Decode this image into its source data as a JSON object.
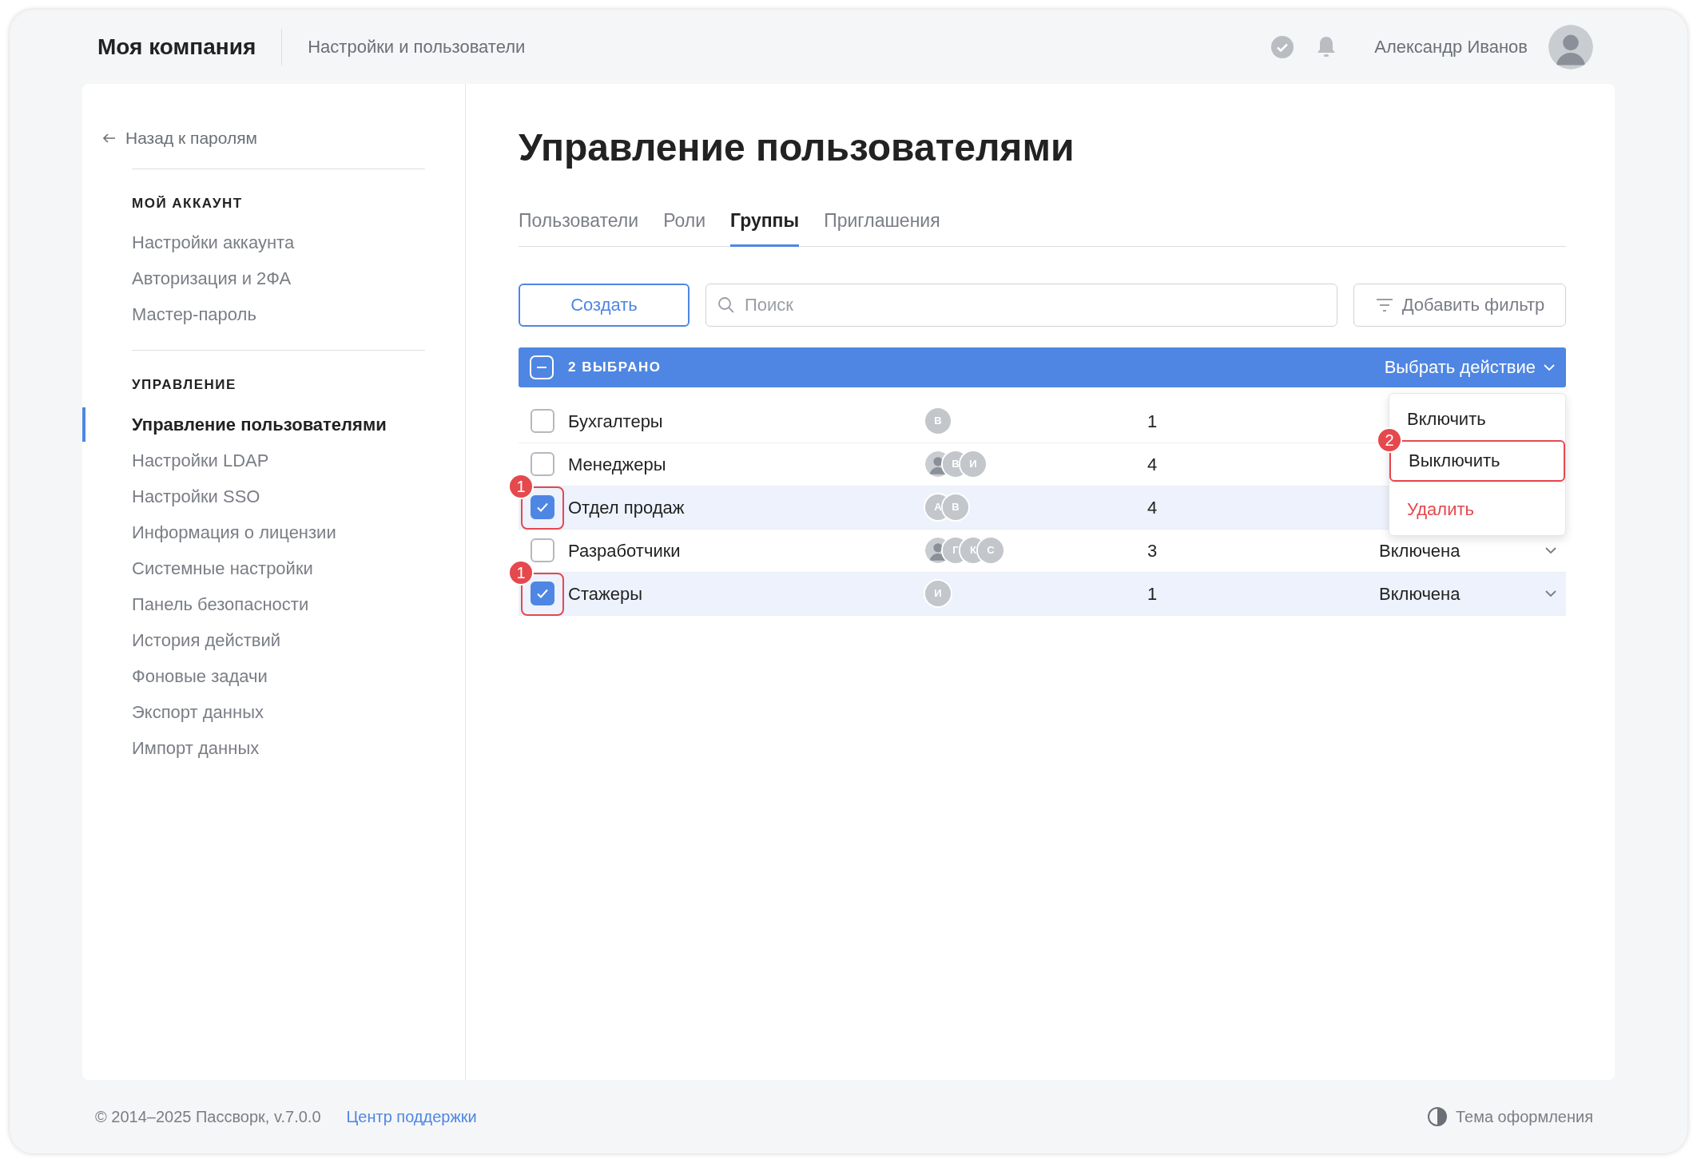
{
  "header": {
    "company": "Моя компания",
    "section": "Настройки и пользователи",
    "user_name": "Александр Иванов"
  },
  "sidebar": {
    "back_link": "Назад к паролям",
    "groups": [
      {
        "title": "МОЙ АККАУНТ",
        "items": [
          {
            "label": "Настройки аккаунта",
            "selected": false
          },
          {
            "label": "Авторизация и 2ФА",
            "selected": false
          },
          {
            "label": "Мастер-пароль",
            "selected": false
          }
        ]
      },
      {
        "title": "УПРАВЛЕНИЕ",
        "items": [
          {
            "label": "Управление пользователями",
            "selected": true
          },
          {
            "label": "Настройки LDAP",
            "selected": false
          },
          {
            "label": "Настройки SSO",
            "selected": false
          },
          {
            "label": "Информация о лицензии",
            "selected": false
          },
          {
            "label": "Системные настройки",
            "selected": false
          },
          {
            "label": "Панель безопасности",
            "selected": false
          },
          {
            "label": "История действий",
            "selected": false
          },
          {
            "label": "Фоновые задачи",
            "selected": false
          },
          {
            "label": "Экспорт данных",
            "selected": false
          },
          {
            "label": "Импорт данных",
            "selected": false
          }
        ]
      }
    ]
  },
  "page": {
    "title": "Управление пользователями",
    "tabs": [
      {
        "label": "Пользователи",
        "selected": false
      },
      {
        "label": "Роли",
        "selected": false
      },
      {
        "label": "Группы",
        "selected": true
      },
      {
        "label": "Приглашения",
        "selected": false
      }
    ],
    "create_button": "Создать",
    "search": {
      "placeholder": "Поиск"
    },
    "filter_button": "Добавить фильтр",
    "selection_bar": {
      "count_label": "2 ВЫБРАНО",
      "action": "Выбрать действие"
    },
    "rows": [
      {
        "name": "Бухгалтеры",
        "selected": false,
        "members": [
          {
            "kind": "initial",
            "initial": "В"
          }
        ],
        "count": "1"
      },
      {
        "name": "Менеджеры",
        "selected": false,
        "members": [
          {
            "kind": "photo"
          },
          {
            "kind": "initial",
            "initial": "В"
          },
          {
            "kind": "initial",
            "initial": "И"
          }
        ],
        "count": "4"
      },
      {
        "name": "Отдел продаж",
        "selected": true,
        "annotation": "1",
        "members": [
          {
            "kind": "initial",
            "initial": "А"
          },
          {
            "kind": "initial",
            "initial": "В"
          }
        ],
        "count": "4"
      },
      {
        "name": "Разработчики",
        "selected": false,
        "members": [
          {
            "kind": "photo"
          },
          {
            "kind": "initial",
            "initial": "Г"
          },
          {
            "kind": "initial",
            "initial": "К"
          },
          {
            "kind": "initial",
            "initial": "С"
          }
        ],
        "count": "3",
        "status": "Включена"
      },
      {
        "name": "Стажеры",
        "selected": true,
        "annotation": "1",
        "members": [
          {
            "kind": "initial",
            "initial": "И"
          }
        ],
        "count": "1",
        "status": "Включена"
      }
    ],
    "action_menu": [
      {
        "label": "Включить",
        "kind": "normal"
      },
      {
        "label": "Выключить",
        "kind": "normal",
        "annotation": "2"
      },
      {
        "label": "Удалить",
        "kind": "danger"
      }
    ]
  },
  "footer": {
    "copyright": "© 2014–2025 Пассворк, v.7.0.0",
    "support_link": "Центр поддержки",
    "theme": "Тема оформления"
  }
}
